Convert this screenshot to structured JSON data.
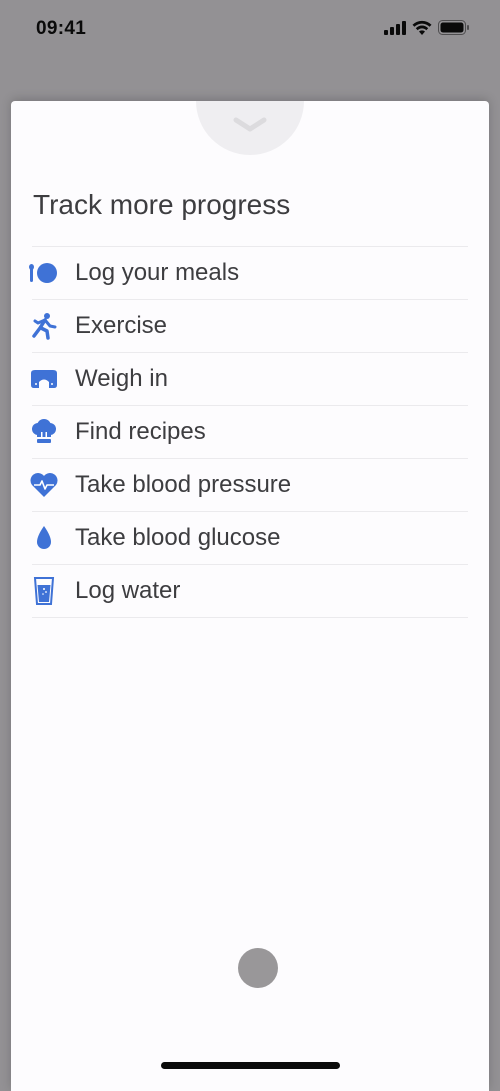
{
  "status_bar": {
    "time": "09:41",
    "icons": [
      "cellular-signal-icon",
      "wifi-icon",
      "battery-icon"
    ]
  },
  "sheet": {
    "dismiss_icon": "chevron-down-icon",
    "title": "Track more progress",
    "items": [
      {
        "label": "Log your meals",
        "icon": "plate-utensil-icon"
      },
      {
        "label": "Exercise",
        "icon": "running-person-icon"
      },
      {
        "label": "Weigh in",
        "icon": "scale-icon"
      },
      {
        "label": "Find recipes",
        "icon": "chef-hat-icon"
      },
      {
        "label": "Take blood pressure",
        "icon": "heart-pulse-icon"
      },
      {
        "label": "Take blood glucose",
        "icon": "drop-icon"
      },
      {
        "label": "Log water",
        "icon": "water-glass-icon"
      }
    ]
  },
  "colors": {
    "accent": "#3f72d6",
    "overlay": "#939194",
    "sheet_bg": "#fdfcfe",
    "text": "#3d3d40",
    "divider": "#ebeaed"
  }
}
